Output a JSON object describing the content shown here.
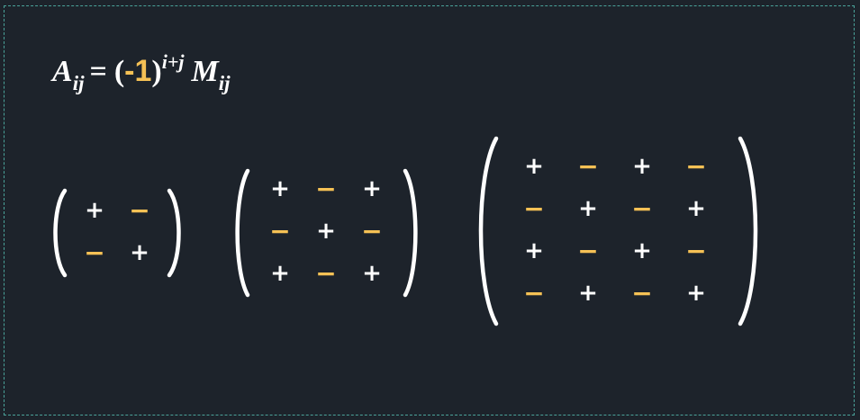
{
  "formula": {
    "lhs_symbol": "A",
    "lhs_subscript": "ij",
    "equals": "=",
    "open_paren": "(",
    "base": "-1",
    "close_paren": ")",
    "exponent": "i+j",
    "rhs_symbol": "M",
    "rhs_subscript": "ij"
  },
  "colors": {
    "background": "#1d232b",
    "frame": "#4aa39a",
    "plus": "#ffffff",
    "minus": "#f5c155",
    "bracket": "#ffffff"
  },
  "signs": {
    "plus": "+",
    "minus": "−"
  },
  "matrices": [
    {
      "name": "sign-matrix-2x2",
      "size": 2,
      "rows": [
        [
          "+",
          "-"
        ],
        [
          "-",
          "+"
        ]
      ]
    },
    {
      "name": "sign-matrix-3x3",
      "size": 3,
      "rows": [
        [
          "+",
          "-",
          "+"
        ],
        [
          "-",
          "+",
          "-"
        ],
        [
          "+",
          "-",
          "+"
        ]
      ]
    },
    {
      "name": "sign-matrix-4x4",
      "size": 4,
      "rows": [
        [
          "+",
          "-",
          "+",
          "-"
        ],
        [
          "-",
          "+",
          "-",
          "+"
        ],
        [
          "+",
          "-",
          "+",
          "-"
        ],
        [
          "-",
          "+",
          "-",
          "+"
        ]
      ]
    }
  ]
}
